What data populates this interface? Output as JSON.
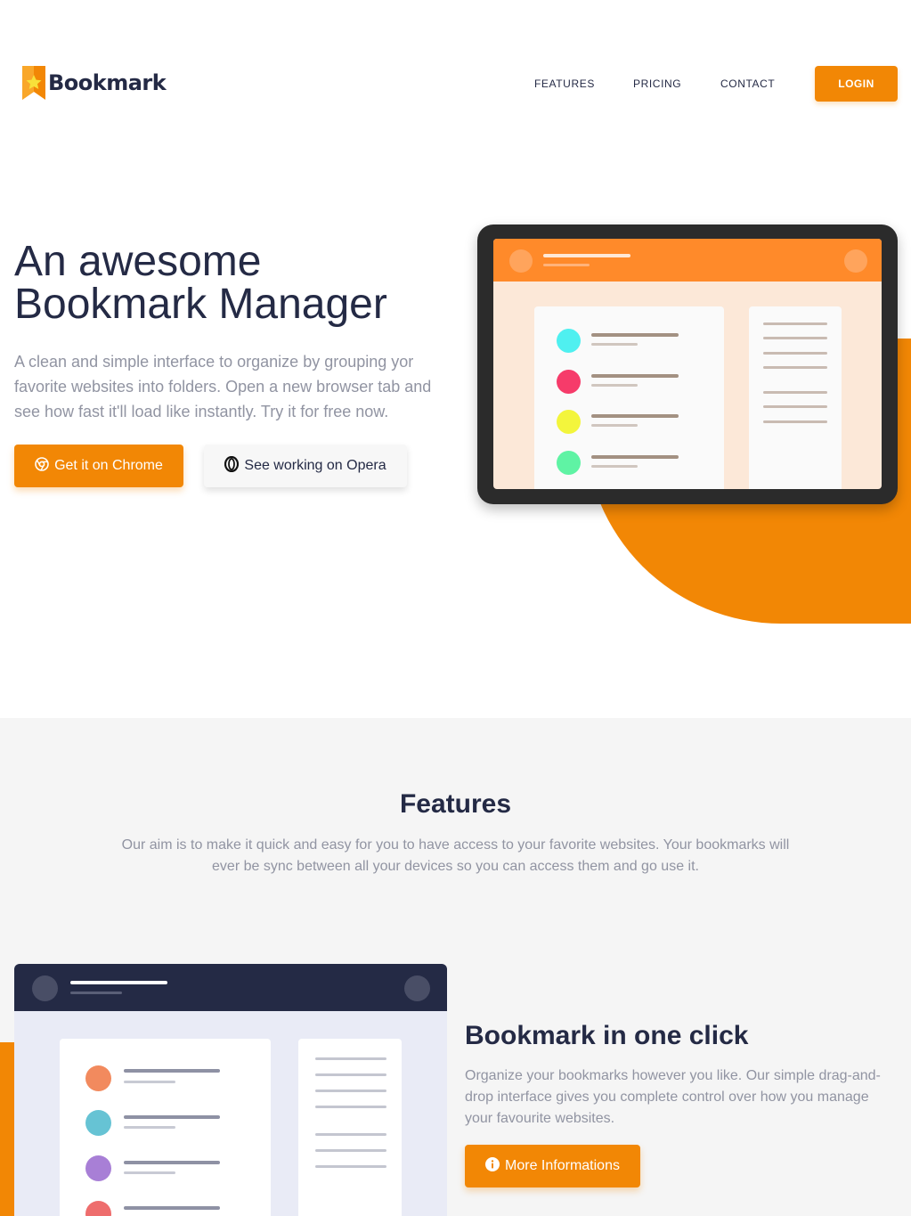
{
  "header": {
    "logo_text": "Bookmark",
    "nav": [
      {
        "label": "FEATURES"
      },
      {
        "label": "PRICING"
      },
      {
        "label": "CONTACT"
      }
    ],
    "login_label": "LOGIN"
  },
  "hero": {
    "title_line1": "An awesome",
    "title_line2": "Bookmark Manager",
    "text": "A clean and simple interface to organize by grouping yor favorite websites into folders. Open a new browser tab and see how fast it'll load like instantly. Try it for free now.",
    "chrome_button": "Get it on Chrome",
    "opera_button": "See working on Opera"
  },
  "features": {
    "title": "Features",
    "text": "Our aim is to make it quick and easy for you to have access to your favorite websites. Your bookmarks will ever be sync between all your devices so you can access them and go use it."
  },
  "feature_item": {
    "title": "Bookmark in one click",
    "text": "Organize your bookmarks however you like. Our simple drag-and-drop interface gives you complete control over how you manage your favourite websites.",
    "button": "More Informations"
  },
  "colors": {
    "accent": "#f28705",
    "dark": "#242a45",
    "muted": "#9194a2",
    "hero_dots": [
      "#4ff0f0",
      "#f63b6a",
      "#f3f53c",
      "#5ff3a4"
    ],
    "feature_dots": [
      "#f28a5e",
      "#66c3d4",
      "#a87fd6",
      "#ee6d6d"
    ]
  },
  "icons": {
    "logo": "bookmark-star-icon",
    "chrome": "chrome-icon",
    "opera": "opera-icon",
    "info": "info-icon"
  }
}
